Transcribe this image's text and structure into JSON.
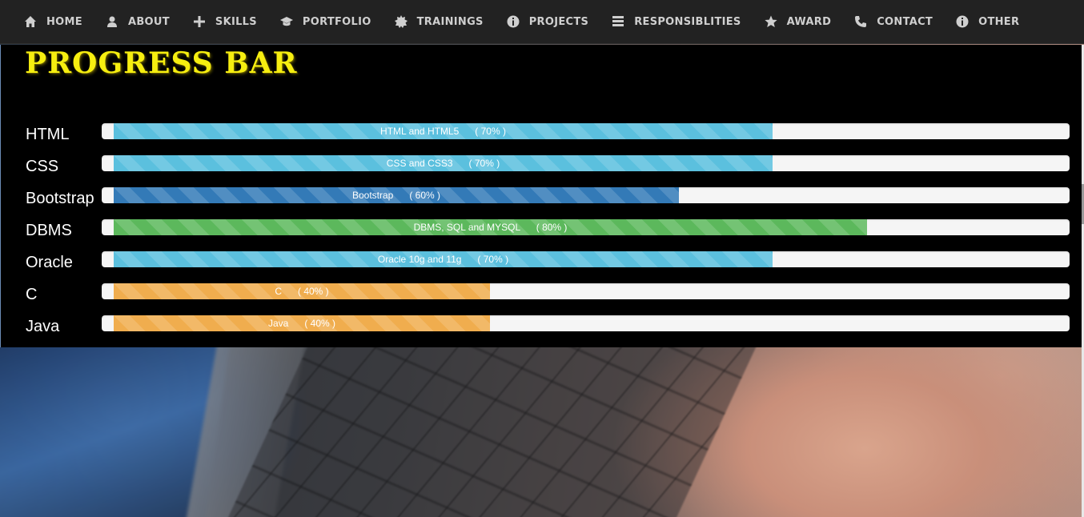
{
  "nav": {
    "items": [
      {
        "label": "HOME",
        "icon": "home-icon"
      },
      {
        "label": "ABOUT",
        "icon": "user-icon"
      },
      {
        "label": "SKILLS",
        "icon": "plus-icon"
      },
      {
        "label": "PORTFOLIO",
        "icon": "graduation-cap-icon"
      },
      {
        "label": "TRAININGS",
        "icon": "certificate-icon"
      },
      {
        "label": "PROJECTS",
        "icon": "info-circle-icon"
      },
      {
        "label": "RESPONSIBLITIES",
        "icon": "tasks-icon"
      },
      {
        "label": "AWARD",
        "icon": "star-icon"
      },
      {
        "label": "CONTACT",
        "icon": "phone-icon"
      },
      {
        "label": "OTHER",
        "icon": "info-circle-icon"
      }
    ]
  },
  "section": {
    "title": "PROGRESS BAR"
  },
  "skills": [
    {
      "name": "HTML",
      "bar_text": "HTML and HTML5      ( 70% )",
      "percent": 70,
      "color": "#5bc0de"
    },
    {
      "name": "CSS",
      "bar_text": "CSS and CSS3      ( 70% )",
      "percent": 70,
      "color": "#5bc0de"
    },
    {
      "name": "Bootstrap",
      "bar_text": "Bootstrap      ( 60% )",
      "percent": 60,
      "color": "#337ab7"
    },
    {
      "name": "DBMS",
      "bar_text": "DBMS, SQL and MYSQL      ( 80% )",
      "percent": 80,
      "color": "#5cb85c"
    },
    {
      "name": "Oracle",
      "bar_text": "Oracle 10g and 11g      ( 70% )",
      "percent": 70,
      "color": "#5bc0de"
    },
    {
      "name": "C",
      "bar_text": "C      ( 40% )",
      "percent": 40,
      "color": "#f0ad4e"
    },
    {
      "name": "Java",
      "bar_text": "Java      ( 40% )",
      "percent": 40,
      "color": "#f0ad4e"
    }
  ],
  "colors": {
    "title": "#f6ee10",
    "panel": "#000000",
    "navbar": "#222222"
  }
}
